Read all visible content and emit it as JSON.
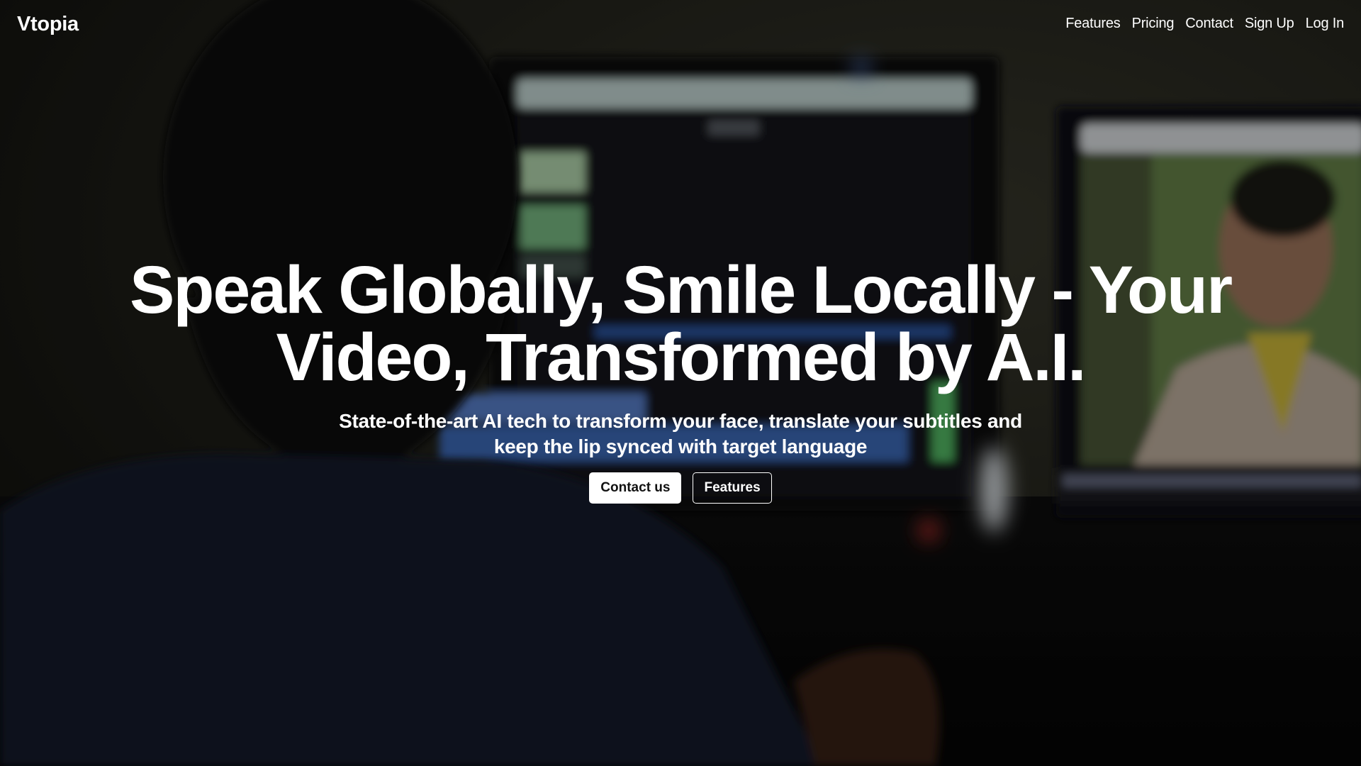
{
  "brand": {
    "name": "Vtopia"
  },
  "nav": {
    "links": [
      {
        "label": "Features"
      },
      {
        "label": "Pricing"
      },
      {
        "label": "Contact"
      },
      {
        "label": "Sign Up"
      },
      {
        "label": "Log In"
      }
    ]
  },
  "hero": {
    "headline": "Speak Globally, Smile Locally - Your Video, Transformed by A.I.",
    "subheadline": "State-of-the-art AI tech to transform your face, translate your subtitles and keep the lip synced with target language",
    "buttons": {
      "primary_label": "Contact us",
      "secondary_label": "Features"
    }
  },
  "background": {
    "description_icon": "video-editing-background-image"
  },
  "colors": {
    "text": "#ffffff",
    "primary_button_bg": "#ffffff",
    "primary_button_text": "#111111"
  }
}
